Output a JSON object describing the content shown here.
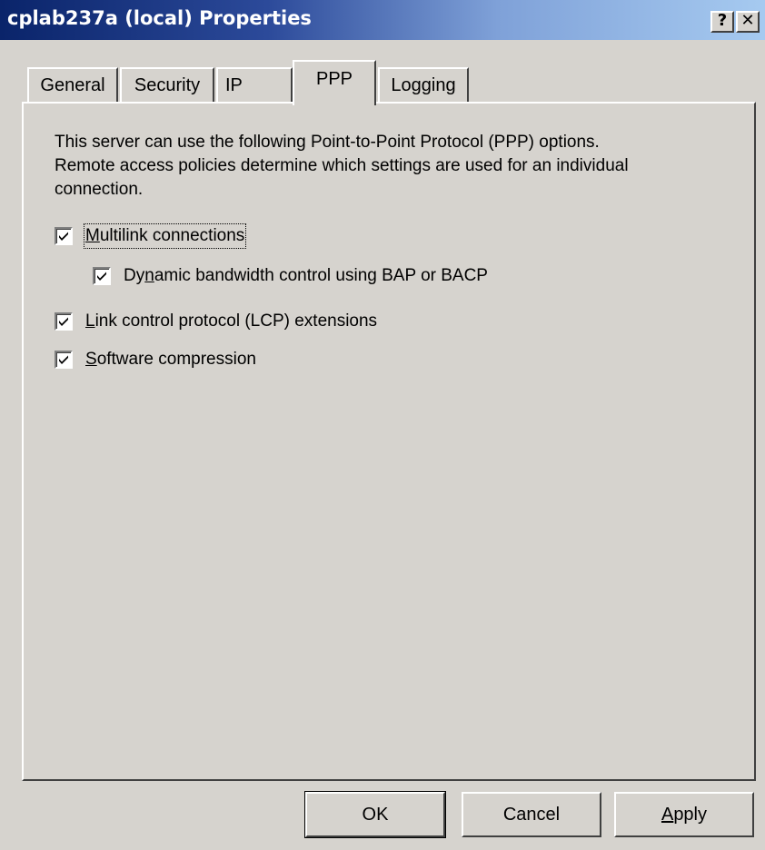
{
  "window": {
    "title": "cplab237a (local) Properties",
    "help_glyph": "?",
    "close_glyph": "✕"
  },
  "tabs": [
    {
      "label": "General",
      "selected": false
    },
    {
      "label": "Security",
      "selected": false
    },
    {
      "label": "IP",
      "selected": false
    },
    {
      "label": "PPP",
      "selected": true
    },
    {
      "label": "Logging",
      "selected": false
    }
  ],
  "description": {
    "line1": "This server can use the following Point-to-Point Protocol (PPP) options.",
    "line2": "Remote access policies determine which settings are used for an individual",
    "line3": "connection."
  },
  "options": {
    "multilink": {
      "mnemonic": "M",
      "rest": "ultilink connections",
      "checked": true
    },
    "bap": {
      "before": "Dy",
      "mnemonic": "n",
      "after": "amic bandwidth control using BAP or BACP",
      "checked": true
    },
    "lcp": {
      "mnemonic": "L",
      "rest": "ink control protocol (LCP) extensions",
      "checked": true
    },
    "compression": {
      "mnemonic": "S",
      "rest": "oftware compression",
      "checked": true
    }
  },
  "buttons": {
    "ok": "OK",
    "cancel": "Cancel",
    "apply_mnemonic": "A",
    "apply_rest": "pply"
  },
  "colors": {
    "titlebar_start": "#0a246a",
    "titlebar_end": "#a6caf0",
    "face": "#d6d3ce"
  },
  "icons": {
    "check": "check-mark-icon",
    "help": "help-icon",
    "close": "close-icon"
  }
}
